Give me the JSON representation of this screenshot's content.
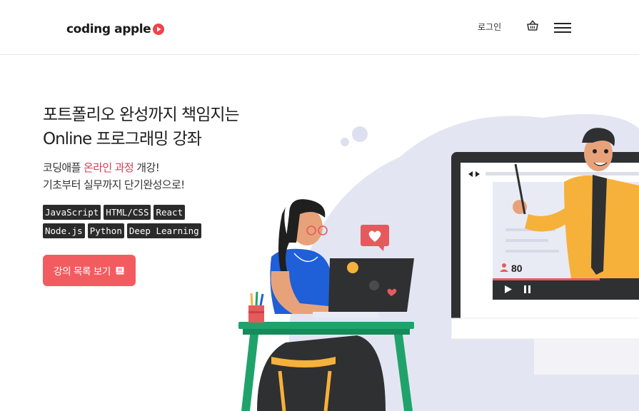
{
  "header": {
    "logo_text": "coding apple",
    "login_label": "로그인",
    "cart_icon": "basket-icon",
    "menu_icon": "hamburger-menu-icon"
  },
  "hero": {
    "title_line1": "포트폴리오 완성까지 책임지는",
    "title_line2": "Online 프로그래밍 강좌",
    "sub_line1_before": "코딩애플 ",
    "sub_line1_accent": "온라인 과정",
    "sub_line1_after": " 개강!",
    "sub_line2": "기초부터 실무까지 단기완성으로!",
    "tags_row1": [
      "JavaScript",
      "HTML/CSS",
      "React"
    ],
    "tags_row2": [
      "Node.js",
      "Python",
      "Deep Learning"
    ],
    "cta_label": "강의 목록 보기",
    "cta_icon": "book-icon"
  },
  "illustration": {
    "viewer_count": "80"
  },
  "colors": {
    "accent": "#f25c60",
    "accent_text": "#d63a53",
    "tag_bg": "#2b2b2b",
    "logo_play": "#f2424a"
  }
}
